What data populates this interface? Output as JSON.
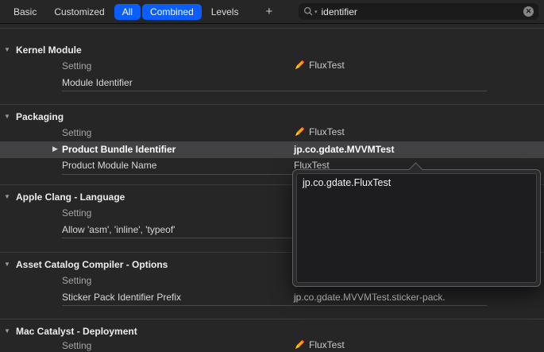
{
  "toolbar": {
    "tabs": [
      {
        "label": "Basic",
        "selected": false
      },
      {
        "label": "Customized",
        "selected": false
      },
      {
        "label": "All",
        "selected": true
      },
      {
        "label": "Combined",
        "selected": true
      },
      {
        "label": "Levels",
        "selected": false
      }
    ],
    "add_button": "+",
    "search": {
      "value": "identifier"
    }
  },
  "icons": {
    "section_collapse": "▼",
    "row_disclosure": "▶",
    "clear_search": "✕",
    "search_scope_chevron": "▾"
  },
  "colors": {
    "accent_blue": "#0a5dff",
    "selected_row": "#424244",
    "background": "#262626"
  },
  "sections": [
    {
      "title": "Kernel Module",
      "column_header": "Setting",
      "target": "FluxTest",
      "rows": [
        {
          "label": "Module Identifier",
          "value": ""
        }
      ]
    },
    {
      "title": "Packaging",
      "column_header": "Setting",
      "target": "FluxTest",
      "rows": [
        {
          "label": "Product Bundle Identifier",
          "value": "jp.co.gdate.MVVMTest",
          "selected": true
        },
        {
          "label": "Product Module Name",
          "value": "FluxTest"
        }
      ]
    },
    {
      "title": "Apple Clang - Language",
      "column_header": "Setting",
      "rows": [
        {
          "label": "Allow 'asm', 'inline', 'typeof'"
        }
      ]
    },
    {
      "title": "Asset Catalog Compiler - Options",
      "column_header": "Setting",
      "rows": [
        {
          "label": "Sticker Pack Identifier Prefix",
          "value": "jp.co.gdate.MVVMTest.sticker-pack."
        }
      ]
    },
    {
      "title": "Mac Catalyst - Deployment",
      "column_header": "Setting",
      "target": "FluxTest",
      "rows": []
    }
  ],
  "popover": {
    "value": "jp.co.gdate.FluxTest"
  }
}
